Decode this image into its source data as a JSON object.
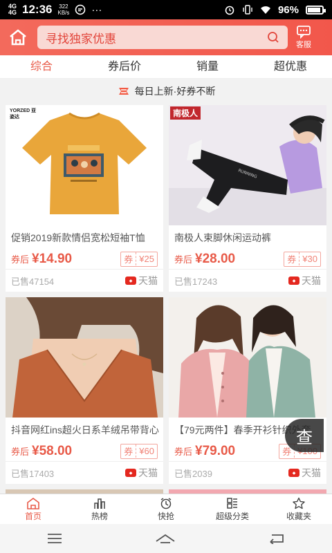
{
  "status": {
    "network": "4G",
    "network2": "4G",
    "time": "12:36",
    "speed_value": "322",
    "speed_unit": "KB/s",
    "more": "···",
    "battery": "96%"
  },
  "header": {
    "search_placeholder": "寻找独家优惠",
    "service_label": "客服",
    "home_icon": "home-icon",
    "search_icon": "search-icon",
    "service_icon": "chat-icon"
  },
  "tabs": [
    "综合",
    "券后价",
    "销量",
    "超优惠"
  ],
  "notice": "每日上新·好券不断",
  "products": [
    {
      "title": "促销2019新款情侣宽松短袖T恤",
      "price_prefix": "券后",
      "price": "¥14.90",
      "coupon_label": "券",
      "coupon_value": "¥25",
      "sold": "已售47154",
      "shop": "天猫",
      "brand_text": "YORZED 亚姿达"
    },
    {
      "title": "南极人束脚休闲运动裤",
      "price_prefix": "券后",
      "price": "¥28.00",
      "coupon_label": "券",
      "coupon_value": "¥30",
      "sold": "已售17243",
      "shop": "天猫",
      "brand_text": "南极人"
    },
    {
      "title": "抖音网红ins超火日系羊绒吊带背心",
      "price_prefix": "券后",
      "price": "¥58.00",
      "coupon_label": "券",
      "coupon_value": "¥60",
      "sold": "已售17403",
      "shop": "天猫",
      "brand_text": ""
    },
    {
      "title": "【79元两件】春季开衫针织外套",
      "price_prefix": "券后",
      "price": "¥79.00",
      "coupon_label": "券",
      "coupon_value": "¥100",
      "sold": "已售2039",
      "shop": "天猫",
      "brand_text": ""
    }
  ],
  "float_button": "查",
  "bottom_nav": [
    "首页",
    "热榜",
    "快抢",
    "超级分类",
    "收藏夹"
  ],
  "colors": {
    "accent": "#e85a48",
    "header": "#f2574b"
  }
}
